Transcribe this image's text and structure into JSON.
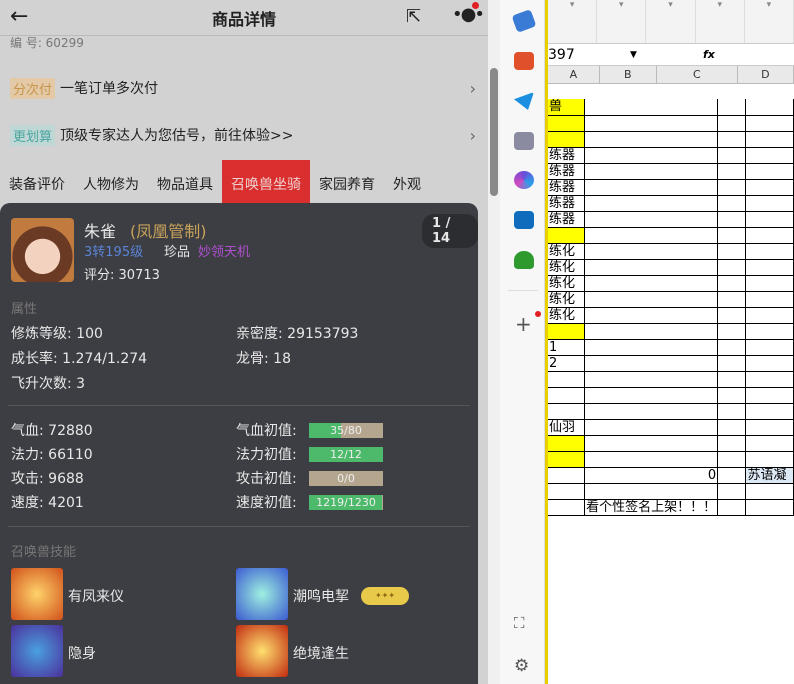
{
  "header": {
    "title": "商品详情",
    "serial": "编 号: 60299"
  },
  "rows": [
    {
      "tag": "分次付",
      "text": "一笔订单多次付"
    },
    {
      "tag": "更划算",
      "text": "顶级专家达人为您估号，前往体验>>"
    }
  ],
  "tabs": [
    "装备评价",
    "人物修为",
    "物品道具",
    "召唤兽坐骑",
    "家园养育",
    "外观"
  ],
  "pet": {
    "name": "朱雀",
    "title": "(凤凰管制)",
    "level": "3转195级",
    "grade": "珍品",
    "tag": "妙领天机",
    "score": "评分: 30713",
    "pager": "1 / 14"
  },
  "attrs_label": "属性",
  "attrs": [
    {
      "label": "修炼等级: 100"
    },
    {
      "label": "亲密度: 29153793"
    },
    {
      "label": "成长率: 1.274/1.274"
    },
    {
      "label": "龙骨: 18"
    },
    {
      "label": "飞升次数: 3"
    }
  ],
  "stats": [
    {
      "label": "气血: 72880",
      "init_label": "气血初值:",
      "init": "35/80",
      "fraction": 0.4375
    },
    {
      "label": "法力: 66110",
      "init_label": "法力初值:",
      "init": "12/12",
      "fraction": 1
    },
    {
      "label": "攻击: 9688",
      "init_label": "攻击初值:",
      "init": "0/0",
      "fraction": 0
    },
    {
      "label": "速度: 4201",
      "init_label": "速度初值:",
      "init": "1219/1230",
      "fraction": 0.991
    }
  ],
  "skills_label": "召唤兽技能",
  "skills": [
    "有凤来仪",
    "潮鸣电挈",
    "隐身",
    "绝境逢生"
  ],
  "excel": {
    "namebox": "397",
    "fx": "fx",
    "cols": [
      "A",
      "B",
      "C",
      "D"
    ],
    "cells": [
      [
        "兽",
        "y"
      ],
      [
        "",
        "y"
      ],
      [
        "",
        "y"
      ],
      [
        "练器",
        ""
      ],
      [
        "练器",
        ""
      ],
      [
        "练器",
        ""
      ],
      [
        "练器",
        ""
      ],
      [
        "练器",
        ""
      ],
      [
        "",
        "y"
      ],
      [
        "练化",
        ""
      ],
      [
        "练化",
        ""
      ],
      [
        "练化",
        ""
      ],
      [
        "练化",
        ""
      ],
      [
        "练化",
        ""
      ],
      [
        "",
        "y"
      ],
      [
        "1",
        ""
      ],
      [
        "2",
        ""
      ],
      [
        "",
        ""
      ],
      [
        "",
        ""
      ],
      [
        "",
        ""
      ],
      [
        "仙羽",
        ""
      ],
      [
        "",
        "y"
      ],
      [
        "",
        "y"
      ],
      [
        "",
        ""
      ],
      [
        "",
        ""
      ],
      [
        "",
        ""
      ]
    ],
    "b_zero": "0",
    "d_text": "苏语凝",
    "sign": "看个性签名上架！！！"
  }
}
